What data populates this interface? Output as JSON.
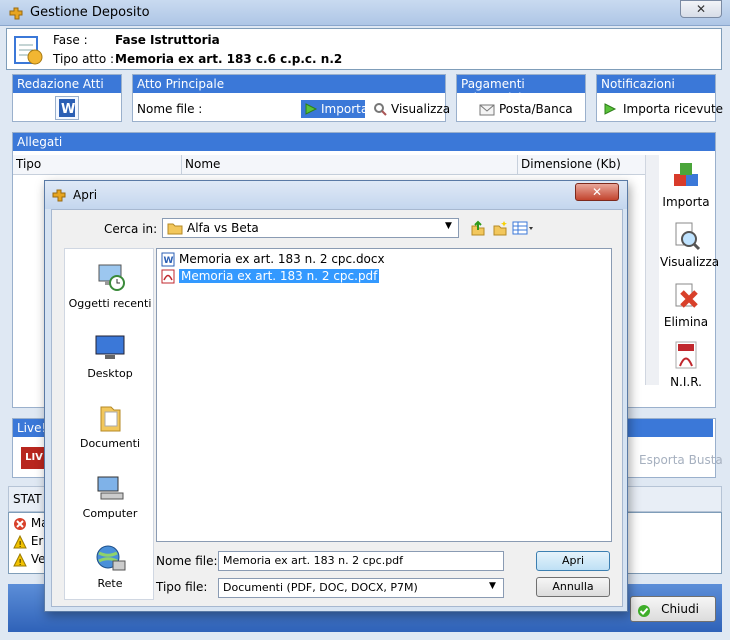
{
  "window": {
    "title": "Gestione Deposito",
    "close_label": "✕"
  },
  "header": {
    "fase_label": "Fase :",
    "fase_value": "Fase Istruttoria",
    "tipo_label": "Tipo atto :",
    "tipo_value": "Memoria ex art. 183 c.6 c.p.c. n.2"
  },
  "sections": {
    "redazione": "Redazione Atti",
    "atto_principale": "Atto Principale",
    "nome_file_label": "Nome file :",
    "importa": "Importa",
    "visualizza": "Visualizza",
    "pagamenti": "Pagamenti Telematici",
    "posta_banca": "Posta/Banca",
    "notifiche": "Notificazioni",
    "importa_ricevute": "Importa ricevute"
  },
  "allegati": {
    "title": "Allegati",
    "columns": [
      "Tipo",
      "Nome",
      "Dimensione (Kb)"
    ]
  },
  "side_actions": [
    "Importa",
    "Visualizza",
    "Elimina",
    "N.I.R."
  ],
  "lower": {
    "live_label": "Live!",
    "esporta_busta": "Esporta Busta",
    "stato_label": "STAT",
    "status_rows": [
      "Ma",
      "Err",
      "Ve"
    ],
    "chiudi": "Chiudi"
  },
  "dialog": {
    "title": "Apri",
    "cerca_in_label": "Cerca in:",
    "cerca_in_value": "Alfa vs Beta",
    "places": [
      "Oggetti recenti",
      "Desktop",
      "Documenti",
      "Computer",
      "Rete"
    ],
    "files": [
      {
        "name": "Memoria ex art. 183 n. 2 cpc.docx",
        "type": "word"
      },
      {
        "name": "Memoria ex art. 183 n. 2 cpc.pdf",
        "type": "pdf"
      }
    ],
    "nome_file_label": "Nome file:",
    "nome_file_value": "Memoria ex art. 183 n. 2 cpc.pdf",
    "tipo_file_label": "Tipo file:",
    "tipo_file_value": "Documenti (PDF, DOC, DOCX, P7M)",
    "apri": "Apri",
    "annulla": "Annulla"
  },
  "colors": {
    "section_header": "#3b78d8",
    "selection": "#3399ff",
    "window_bg": "#dfe8f3"
  }
}
